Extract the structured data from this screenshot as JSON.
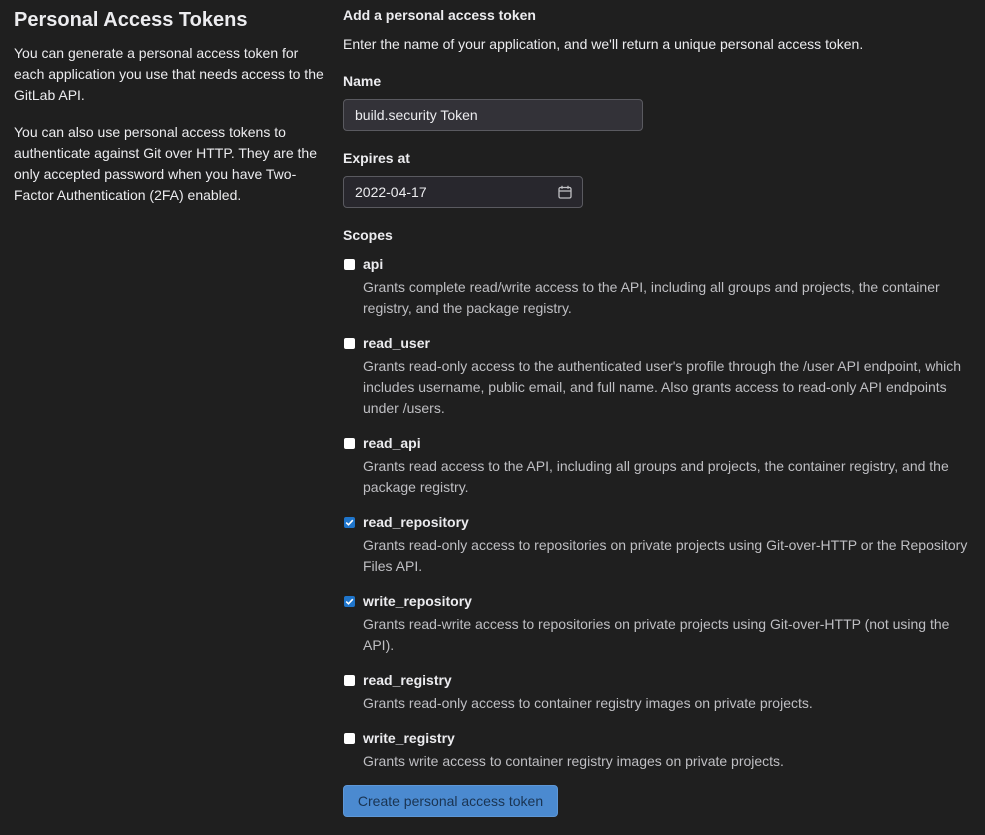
{
  "left": {
    "title": "Personal Access Tokens",
    "paragraph1": "You can generate a personal access token for each application you use that needs access to the GitLab API.",
    "paragraph2": "You can also use personal access tokens to authenticate against Git over HTTP. They are the only accepted password when you have Two-Factor Authentication (2FA) enabled."
  },
  "form": {
    "title": "Add a personal access token",
    "description": "Enter the name of your application, and we'll return a unique personal access token.",
    "name_label": "Name",
    "name_value": "build.security Token",
    "expires_label": "Expires at",
    "expires_value": "2022-04-17",
    "calendar_icon": "calendar-icon",
    "scopes_label": "Scopes",
    "scopes": [
      {
        "name": "api",
        "checked": false,
        "description": "Grants complete read/write access to the API, including all groups and projects, the container registry, and the package registry."
      },
      {
        "name": "read_user",
        "checked": false,
        "description": "Grants read-only access to the authenticated user's profile through the /user API endpoint, which includes username, public email, and full name. Also grants access to read-only API endpoints under /users."
      },
      {
        "name": "read_api",
        "checked": false,
        "description": "Grants read access to the API, including all groups and projects, the container registry, and the package registry."
      },
      {
        "name": "read_repository",
        "checked": true,
        "description": "Grants read-only access to repositories on private projects using Git-over-HTTP or the Repository Files API."
      },
      {
        "name": "write_repository",
        "checked": true,
        "description": "Grants read-write access to repositories on private projects using Git-over-HTTP (not using the API)."
      },
      {
        "name": "read_registry",
        "checked": false,
        "description": "Grants read-only access to container registry images on private projects."
      },
      {
        "name": "write_registry",
        "checked": false,
        "description": "Grants write access to container registry images on private projects."
      }
    ],
    "submit_label": "Create personal access token"
  },
  "colors": {
    "background": "#1f1f1f",
    "checkbox_checked": "#1f75cb",
    "button": "#4b8ad0"
  }
}
